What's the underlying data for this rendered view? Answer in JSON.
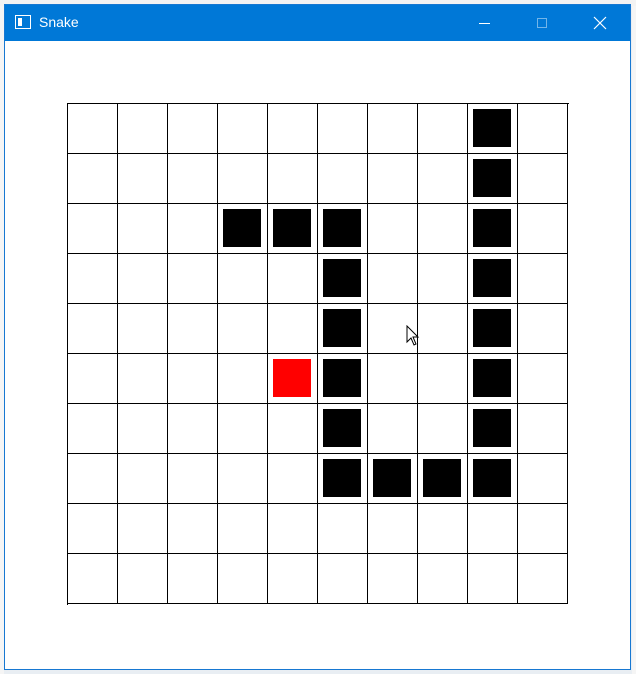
{
  "window": {
    "title": "Snake",
    "accent": "#0078d7",
    "icons": {
      "app": "window-app-icon",
      "minimize": "minimize-icon",
      "maximize": "maximize-icon",
      "close": "close-icon"
    },
    "close_glyph": "✕"
  },
  "board": {
    "columns": 10,
    "rows": 10,
    "snake_color": "#000000",
    "food_color": "#ff0000",
    "snake": [
      [
        8,
        0
      ],
      [
        8,
        1
      ],
      [
        8,
        2
      ],
      [
        8,
        3
      ],
      [
        8,
        4
      ],
      [
        8,
        5
      ],
      [
        8,
        6
      ],
      [
        8,
        7
      ],
      [
        7,
        7
      ],
      [
        6,
        7
      ],
      [
        5,
        7
      ],
      [
        5,
        6
      ],
      [
        5,
        5
      ],
      [
        5,
        4
      ],
      [
        5,
        3
      ],
      [
        5,
        2
      ],
      [
        4,
        2
      ],
      [
        3,
        2
      ]
    ],
    "food": [
      4,
      5
    ]
  }
}
